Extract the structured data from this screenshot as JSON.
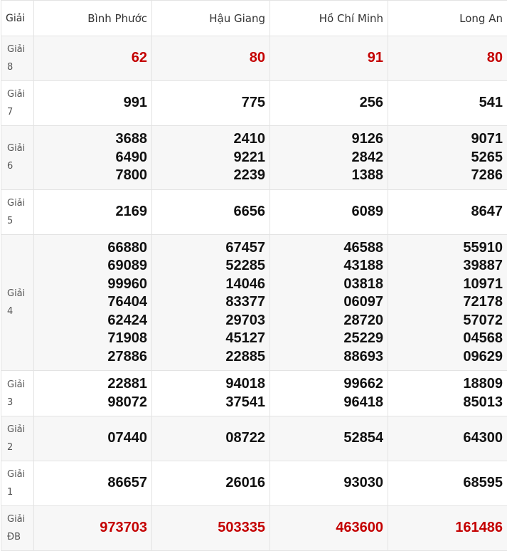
{
  "header": {
    "prize_label": "Giải",
    "provinces": [
      "Bình Phước",
      "Hậu Giang",
      "Hồ Chí Minh",
      "Long An"
    ]
  },
  "rows": [
    {
      "label": [
        "Giải",
        "8"
      ],
      "highlight": true,
      "cells": [
        [
          "62"
        ],
        [
          "80"
        ],
        [
          "91"
        ],
        [
          "80"
        ]
      ]
    },
    {
      "label": [
        "Giải",
        "7"
      ],
      "highlight": false,
      "cells": [
        [
          "991"
        ],
        [
          "775"
        ],
        [
          "256"
        ],
        [
          "541"
        ]
      ]
    },
    {
      "label": [
        "Giải",
        "6"
      ],
      "highlight": false,
      "cells": [
        [
          "3688",
          "6490",
          "7800"
        ],
        [
          "2410",
          "9221",
          "2239"
        ],
        [
          "9126",
          "2842",
          "1388"
        ],
        [
          "9071",
          "5265",
          "7286"
        ]
      ]
    },
    {
      "label": [
        "Giải",
        "5"
      ],
      "highlight": false,
      "cells": [
        [
          "2169"
        ],
        [
          "6656"
        ],
        [
          "6089"
        ],
        [
          "8647"
        ]
      ]
    },
    {
      "label": [
        "Giải",
        "4"
      ],
      "highlight": false,
      "cells": [
        [
          "66880",
          "69089",
          "99960",
          "76404",
          "62424",
          "71908",
          "27886"
        ],
        [
          "67457",
          "52285",
          "14046",
          "83377",
          "29703",
          "45127",
          "22885"
        ],
        [
          "46588",
          "43188",
          "03818",
          "06097",
          "28720",
          "25229",
          "88693"
        ],
        [
          "55910",
          "39887",
          "10971",
          "72178",
          "57072",
          "04568",
          "09629"
        ]
      ]
    },
    {
      "label": [
        "Giải",
        "3"
      ],
      "highlight": false,
      "cells": [
        [
          "22881",
          "98072"
        ],
        [
          "94018",
          "37541"
        ],
        [
          "99662",
          "96418"
        ],
        [
          "18809",
          "85013"
        ]
      ]
    },
    {
      "label": [
        "Giải",
        "2"
      ],
      "highlight": false,
      "cells": [
        [
          "07440"
        ],
        [
          "08722"
        ],
        [
          "52854"
        ],
        [
          "64300"
        ]
      ]
    },
    {
      "label": [
        "Giải",
        "1"
      ],
      "highlight": false,
      "cells": [
        [
          "86657"
        ],
        [
          "26016"
        ],
        [
          "93030"
        ],
        [
          "68595"
        ]
      ]
    },
    {
      "label": [
        "Giải",
        "ĐB"
      ],
      "highlight": true,
      "cells": [
        [
          "973703"
        ],
        [
          "503335"
        ],
        [
          "463600"
        ],
        [
          "161486"
        ]
      ]
    }
  ],
  "colors": {
    "highlight_number": "#c40000",
    "number": "#111111",
    "row_alt_background": "#f7f7f7",
    "border": "#e3e3e3"
  }
}
